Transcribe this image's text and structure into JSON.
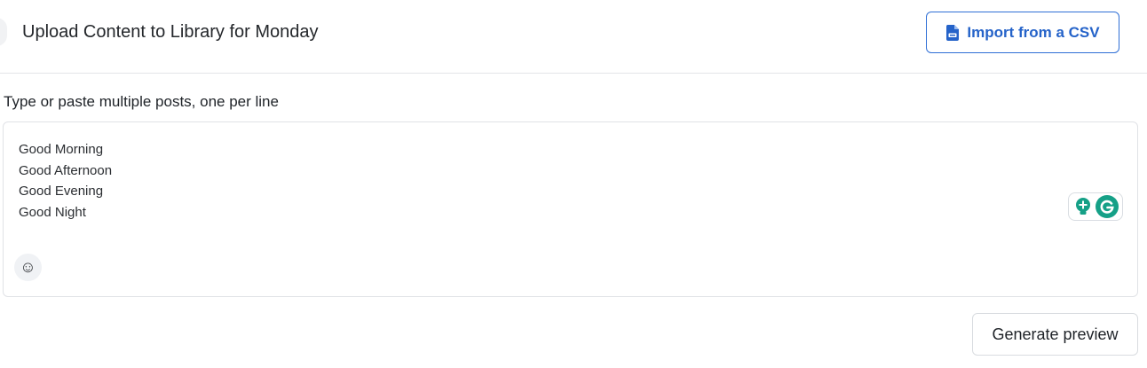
{
  "header": {
    "title": "Upload Content to Library for Monday",
    "import_button_label": "Import from a CSV",
    "import_icon": "csv-file-icon"
  },
  "editor": {
    "label": "Type or paste multiple posts, one per line",
    "lines": [
      "Good Morning",
      "Good Afternoon",
      "Good Evening",
      "Good Night"
    ],
    "emoji_icon": "☺",
    "grammarly_icons": [
      "grammarly-suggestion-icon",
      "grammarly-logo-icon"
    ]
  },
  "footer": {
    "generate_button_label": "Generate preview"
  },
  "colors": {
    "accent": "#2563c9",
    "grammarly_green": "#15a087",
    "border": "#e0e2e6"
  }
}
